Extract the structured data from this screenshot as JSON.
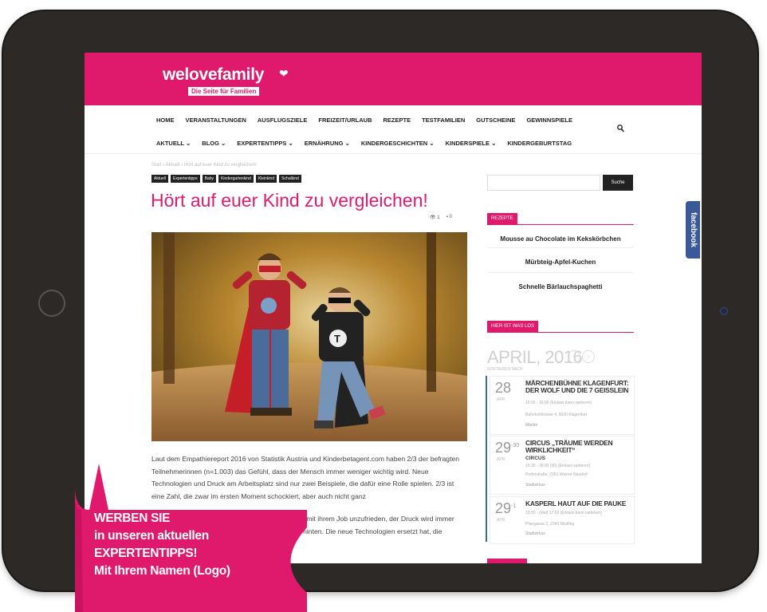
{
  "site": {
    "logo_text": "welovefamily",
    "logo_sub": "Die Seite für Familien",
    "nav_row1": [
      "HOME",
      "VERANSTALTUNGEN",
      "AUSFLUGSZIELE",
      "FREIZEIT/URLAUB",
      "REZEPTE",
      "TESTFAMILIEN",
      "GUTSCHEINE",
      "GEWINNSPIELE"
    ],
    "nav_row2": [
      "AKTUELL ⌄",
      "BLOG ⌄",
      "EXPERTENTIPPS ⌄",
      "ERNÄHRUNG ⌄",
      "KINDERGESCHICHTEN ⌄",
      "KINDERSPIELE ⌄",
      "KINDERGEBURTSTAG"
    ],
    "brand_color": "#df1a6d"
  },
  "article": {
    "breadcrumb": "Start › Aktuell › Hört auf euer Kind zu vergleichen!",
    "tags": [
      "Aktuell",
      "Expertentipps",
      "Baby",
      "Kindergartenkind",
      "Kleinkind",
      "Schulkind"
    ],
    "title": "Hört auf euer Kind zu vergleichen!",
    "views": "1",
    "comments": "0",
    "paragraph1": "Laut dem Empathiereport 2016 von Statistik Austria und Kinderbetagent.com haben 2/3 der befragten Teilnehmerinnen (n=1.003) das Gefühl, dass der Mensch immer weniger wichtig wird. Neue Technologien und Druck am Arbeitsplatz sind nur zwei Beispiele, die dafür eine Rolle spielen. 2/3 ist eine Zahl, die zwar im ersten Moment schockiert, aber auch nicht ganz",
    "paragraph2": "Die Menschen fühlen sich weniger gebraucht, sind mit ihrem Job unzufrieden, der Druck wird immer größer. Sie kommen, dennoch nicht es vorne und hinten. Die neue Technologien ersetzt hat, die"
  },
  "sidebar": {
    "search_button": "Suche",
    "recipes_label": "REZEPTE",
    "recipes": [
      "Mousse au Chocolate im Kekskörbchen",
      "Mürbteig-Apfel-Kuchen",
      "Schnelle Bärlauchspaghetti"
    ],
    "events_label": "HIER IST WAS LOS",
    "month": "APRIL, 2016",
    "sort_label": "SORTIEREN NACH",
    "events": [
      {
        "day": "28",
        "month": "APR",
        "title": "MÄRCHENBÜHNE KLAGENFURT: DER WOLF UND DIE 7 GEISSLEIN",
        "time": "15:00 - 16:00 (Einlass kann variieren)",
        "place": "Bahnhofstrasse 4, 9020 Klagenfurt",
        "org": "Märkte"
      },
      {
        "day": "29",
        "sup": "-30",
        "month": "APR",
        "title": "CIRCUS „TRÄUME WERDEN WIRKLICHKEIT“",
        "title2": "CIRCUS",
        "time": "15:30 - 18:00 (30) (Einlass variieren)",
        "place": "Prehnstraße, 2351 Wiener Neudorf",
        "org": "Stadtzirkus"
      },
      {
        "day": "29",
        "sup": "-1",
        "month": "APR",
        "title": "KASPERL HAUT AUF DIE PAUKE",
        "time": "15:00 - (Mai) 17:00 (Einlass kann variieren)",
        "place": "Pfarrgasse 2, 2340 Mödling",
        "org": "Stadtzirkus"
      }
    ]
  },
  "facebook_tab": "facebook",
  "promo": {
    "line1": "WERBEN SIE",
    "line2": "in unseren aktuellen",
    "line3": "EXPERTENTIPPS!",
    "line4": "Mit Ihrem Namen (Logo)"
  }
}
